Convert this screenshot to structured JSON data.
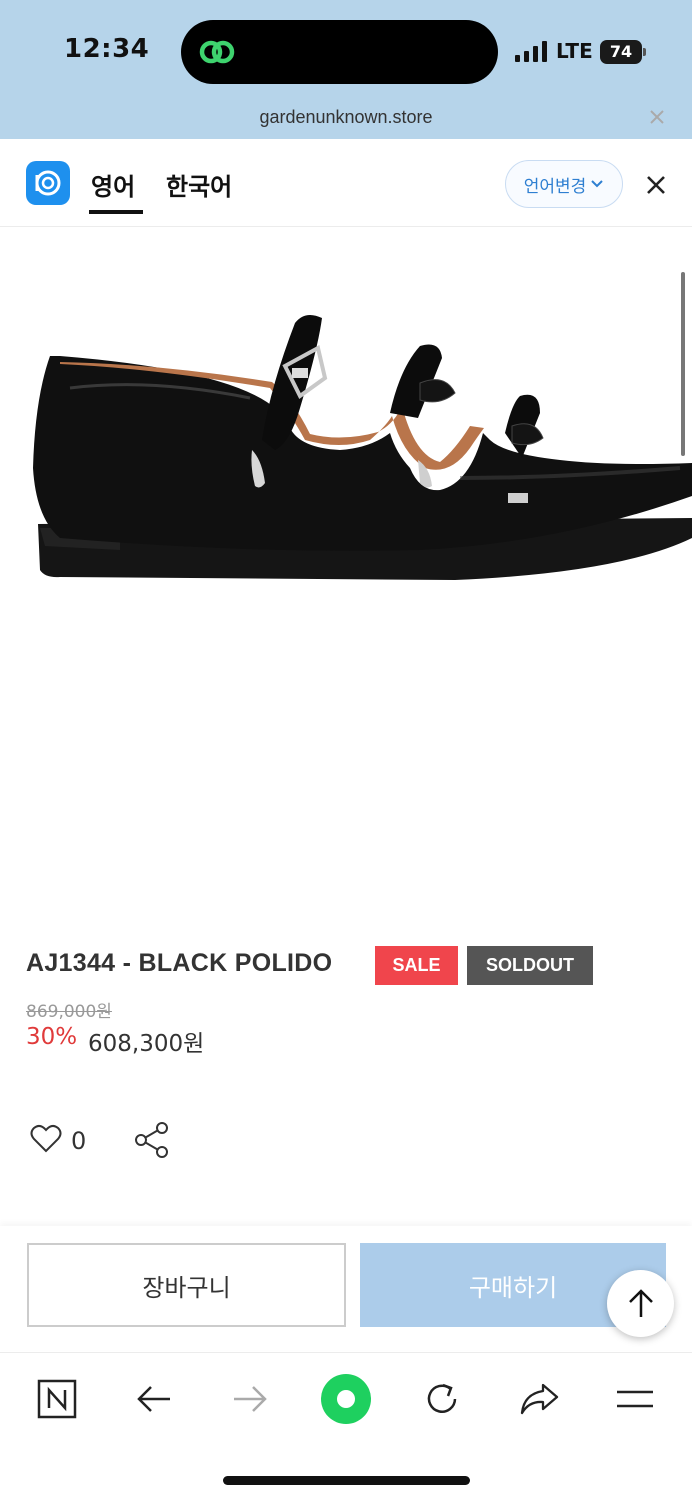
{
  "status_bar": {
    "time": "12:34",
    "network": "LTE",
    "battery": "74"
  },
  "browser": {
    "url": "gardenunknown.store"
  },
  "translate_bar": {
    "tabs": [
      {
        "label": "영어",
        "active": true
      },
      {
        "label": "한국어",
        "active": false
      }
    ],
    "change_language_label": "언어변경"
  },
  "product": {
    "title": "AJ1344 - BLACK POLIDO",
    "badges": {
      "sale": "SALE",
      "soldout": "SOLDOUT"
    },
    "original_price": "869,000원",
    "discount_rate": "30%",
    "sale_price": "608,300원",
    "like_count": "0"
  },
  "actions": {
    "cart_label": "장바구니",
    "buy_label": "구매하기"
  },
  "colors": {
    "status_bg": "#b6d4ea",
    "sale_badge": "#f0454c",
    "soldout_badge": "#555555",
    "discount": "#e03a3a",
    "buy_button": "#acccea",
    "accent_blue": "#1e90ee",
    "naver_green": "#1ed05f"
  },
  "icons": {
    "island_app": "link-icon",
    "like": "heart-icon",
    "share": "share-icon",
    "scroll_top": "arrow-up-icon",
    "toolbar": [
      "naver-icon",
      "back-arrow-icon",
      "forward-arrow-icon",
      "green-dot-icon",
      "reload-icon",
      "share-arrow-icon",
      "menu-icon"
    ]
  }
}
